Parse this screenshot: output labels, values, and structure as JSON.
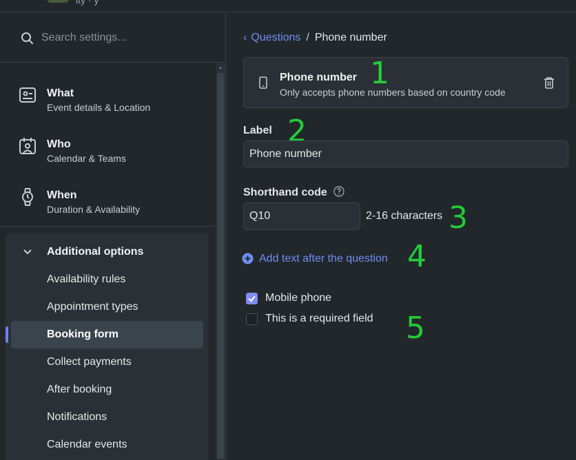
{
  "topbar": {
    "app_title": "ity · y"
  },
  "search": {
    "placeholder": "Search settings..."
  },
  "sidebar": {
    "items": [
      {
        "title": "What",
        "subtitle": "Event details & Location",
        "icon": "id-card-icon"
      },
      {
        "title": "Who",
        "subtitle": "Calendar & Teams",
        "icon": "calendar-user-icon"
      },
      {
        "title": "When",
        "subtitle": "Duration & Availability",
        "icon": "watch-icon"
      }
    ],
    "additional_options": {
      "label": "Additional options",
      "items": [
        {
          "label": "Availability rules"
        },
        {
          "label": "Appointment types"
        },
        {
          "label": "Booking form",
          "active": true
        },
        {
          "label": "Collect payments"
        },
        {
          "label": "After booking"
        },
        {
          "label": "Notifications"
        },
        {
          "label": "Calendar events"
        }
      ]
    }
  },
  "breadcrumb": {
    "parent": "Questions",
    "separator": "/",
    "current": "Phone number"
  },
  "field_card": {
    "title": "Phone number",
    "description": "Only accepts phone numbers based on country code"
  },
  "form": {
    "label_title": "Label",
    "label_value": "Phone number",
    "shorthand_title": "Shorthand code",
    "shorthand_value": "Q10",
    "shorthand_hint": "2-16 characters",
    "add_text": "Add text after the question",
    "checkboxes": [
      {
        "label": "Mobile phone",
        "checked": true
      },
      {
        "label": "This is a required field",
        "checked": false
      }
    ]
  },
  "annotations": [
    "1",
    "2",
    "3",
    "4",
    "5"
  ],
  "colors": {
    "accent": "#6f8df5",
    "annotation": "#22cc3a",
    "checkbox": "#7f8cf2"
  }
}
